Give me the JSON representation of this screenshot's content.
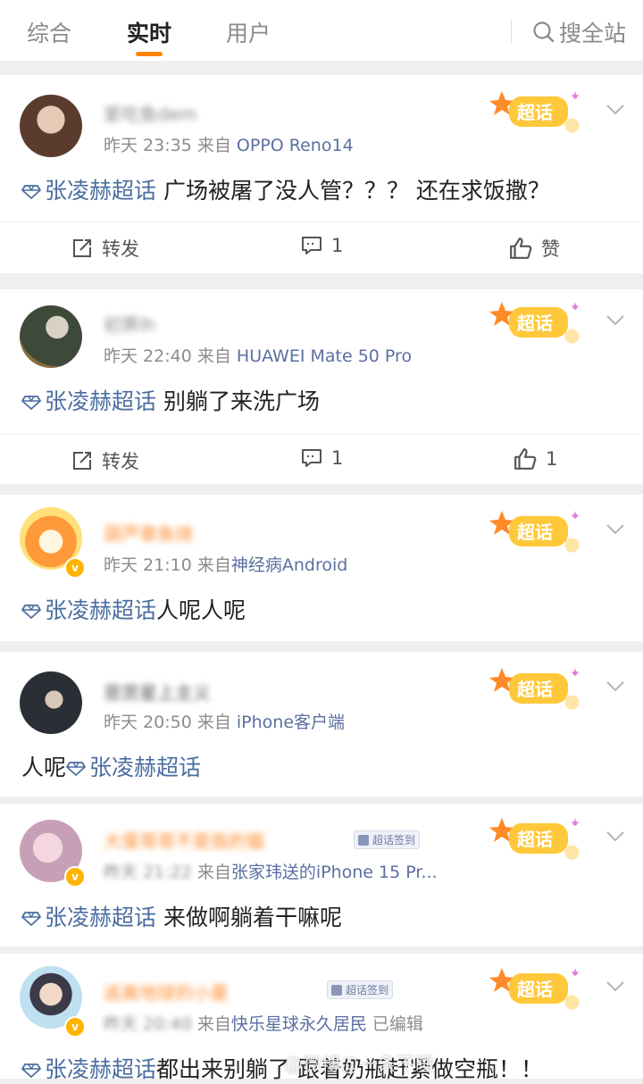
{
  "tabs": [
    {
      "label": "综合"
    },
    {
      "label": "实时"
    },
    {
      "label": "用户"
    }
  ],
  "search_label": "搜全站",
  "colors": {
    "accent": "#ff8200",
    "topic": "#4a6ea0",
    "username_orange": "#ff8a2a"
  },
  "chaohua_label": "超话",
  "actions": {
    "repost": "转发",
    "like": "赞"
  },
  "posts": [
    {
      "username": "爱吃鱼dem",
      "time": "昨天 23:35",
      "from_prefix": "来自",
      "source": "OPPO Reno14",
      "topic": "张凌赫超话",
      "text": "广场被屠了没人管？？？ 还在求饭撒？",
      "comments": "1",
      "likes": "赞"
    },
    {
      "username": "初霁lh",
      "time": "昨天 22:40",
      "from_prefix": "来自",
      "source": "HUAWEI Mate 50 Pro",
      "topic": "张凌赫超话",
      "text": "别躺了来洗广场",
      "comments": "1",
      "likes": "1"
    },
    {
      "username": "葫芦章鱼烧",
      "time": "昨天 21:10",
      "from_prefix": "来自",
      "source": "神经病Android",
      "topic": "张凌赫超话",
      "text": "人呢人呢"
    },
    {
      "username": "恩赏星上主义",
      "time": "昨天 20:50",
      "from_prefix": "来自",
      "source": "iPhone客户端",
      "prefix_text": "人呢",
      "topic": "张凌赫超话"
    },
    {
      "username": "大蛋哥哥不是我的猫",
      "badge": "超话签到",
      "time": "昨天 21:22",
      "from_prefix": "来自",
      "source": "张家玮送的iPhone 15 Pr...",
      "topic": "张凌赫超话",
      "text": "来做啊躺着干嘛呢"
    },
    {
      "username": "逃离地球的小夏",
      "badge": "超话签到",
      "time": "昨天 20:40",
      "from_prefix": "来自",
      "source": "快乐星球永久居民",
      "edited": "已编辑",
      "topic": "张凌赫超话",
      "text": "都出来别躺了 跟着奶瓶赶紧做空瓶！！"
    }
  ],
  "watermark": "@微博@一条不睡"
}
